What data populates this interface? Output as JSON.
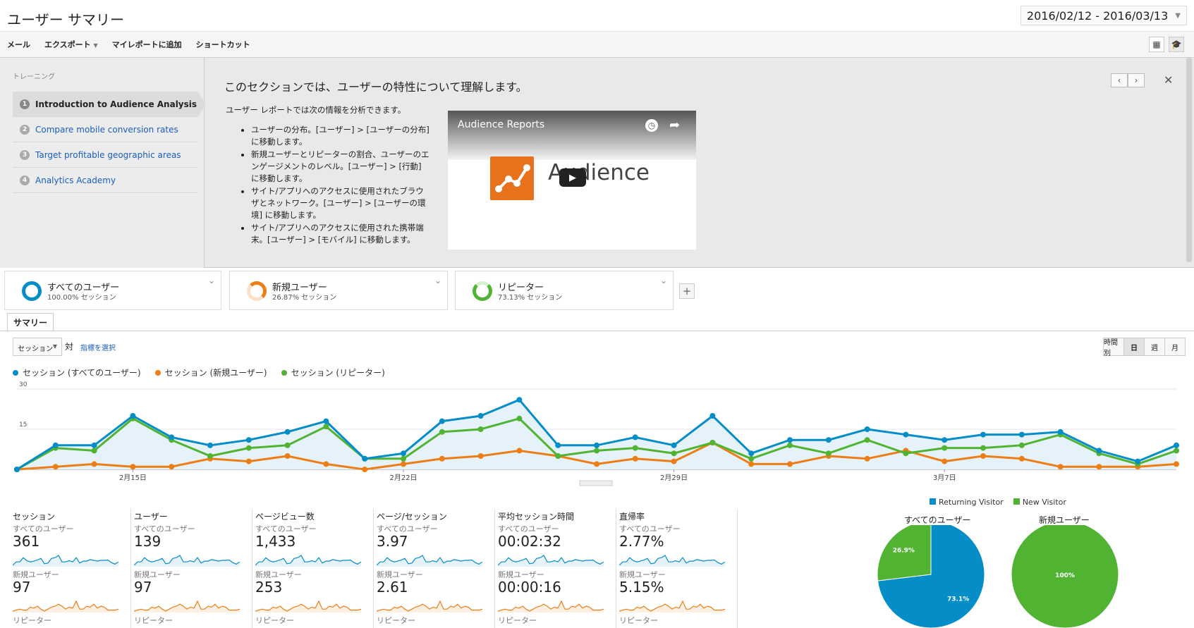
{
  "header": {
    "title": "ユーザー サマリー",
    "date_range": "2016/02/12 - 2016/03/13"
  },
  "toolbar": {
    "items": [
      "メール",
      "エクスポート",
      "マイレポートに追加",
      "ショートカット"
    ]
  },
  "training": {
    "label": "トレーニング",
    "items": [
      {
        "num": "1",
        "label": "Introduction to Audience Analysis"
      },
      {
        "num": "2",
        "label": "Compare mobile conversion rates"
      },
      {
        "num": "3",
        "label": "Target profitable geographic areas"
      },
      {
        "num": "4",
        "label": "Analytics Academy"
      }
    ],
    "heading": "このセクションでは、ユーザーの特性について理解します。",
    "intro": "ユーザー レポートでは次の情報を分析できます。",
    "bullets": [
      "ユーザーの分布。[ユーザー] > [ユーザーの分布] に移動します。",
      "新規ユーザーとリピーターの割合、ユーザーのエンゲージメントのレベル。[ユーザー] > [行動] に移動します。",
      "サイト/アプリへのアクセスに使用されたブラウザとネットワーク。[ユーザー] > [ユーザーの環境] に移動します。",
      "サイト/アプリへのアクセスに使用された携帯端末。[ユーザー] > [モバイル] に移動します。"
    ],
    "video": {
      "title": "Audience Reports",
      "wordmark": "Audience"
    }
  },
  "segments": [
    {
      "name": "すべてのユーザー",
      "pct": "100.00% セッション",
      "color": "#058dc7"
    },
    {
      "name": "新規ユーザー",
      "pct": "26.87% セッション",
      "color": "#ed7e17"
    },
    {
      "name": "リピーター",
      "pct": "73.13% セッション",
      "color": "#50b432"
    }
  ],
  "tabs": {
    "summary": "サマリー"
  },
  "controls": {
    "metric_select": "セッション",
    "vs": "対",
    "choose_metric": "指標を選択",
    "granularity": [
      "時間別",
      "日",
      "週",
      "月"
    ],
    "granularity_active": "日"
  },
  "chart_data": {
    "type": "line",
    "yticks": [
      30,
      15
    ],
    "ylim": [
      0,
      30
    ],
    "xtick_labels": [
      "2月15日",
      "2月22日",
      "2月29日",
      "3月7日"
    ],
    "xtick_index": [
      3,
      10,
      17,
      24
    ],
    "series": [
      {
        "name": "セッション (すべてのユーザー)",
        "color": "#058dc7",
        "values": [
          0,
          9,
          9,
          20,
          12,
          9,
          11,
          14,
          18,
          4,
          6,
          18,
          20,
          26,
          9,
          9,
          12,
          9,
          20,
          6,
          11,
          11,
          15,
          13,
          11,
          13,
          13,
          14,
          7,
          3,
          9
        ]
      },
      {
        "name": "セッション (新規ユーザー)",
        "color": "#ed7e17",
        "values": [
          0,
          1,
          2,
          1,
          1,
          4,
          3,
          5,
          2,
          0,
          2,
          4,
          5,
          7,
          5,
          2,
          4,
          3,
          10,
          2,
          2,
          5,
          4,
          7,
          3,
          5,
          4,
          1,
          1,
          1,
          2
        ]
      },
      {
        "name": "セッション (リピーター)",
        "color": "#50b432",
        "values": [
          0,
          8,
          7,
          19,
          11,
          5,
          8,
          9,
          16,
          4,
          4,
          14,
          15,
          19,
          5,
          7,
          8,
          6,
          10,
          4,
          9,
          6,
          11,
          6,
          8,
          8,
          9,
          13,
          6,
          2,
          7
        ]
      }
    ]
  },
  "metrics": [
    {
      "name": "セッション",
      "rows": [
        {
          "label": "すべてのユーザー",
          "value": "361"
        },
        {
          "label": "新規ユーザー",
          "value": "97"
        },
        {
          "label": "リピーター",
          "value": ""
        }
      ]
    },
    {
      "name": "ユーザー",
      "rows": [
        {
          "label": "すべてのユーザー",
          "value": "139"
        },
        {
          "label": "新規ユーザー",
          "value": "97"
        },
        {
          "label": "リピーター",
          "value": ""
        }
      ]
    },
    {
      "name": "ページビュー数",
      "rows": [
        {
          "label": "すべてのユーザー",
          "value": "1,433"
        },
        {
          "label": "新規ユーザー",
          "value": "253"
        },
        {
          "label": "リピーター",
          "value": ""
        }
      ]
    },
    {
      "name": "ページ/セッション",
      "rows": [
        {
          "label": "すべてのユーザー",
          "value": "3.97"
        },
        {
          "label": "新規ユーザー",
          "value": "2.61"
        },
        {
          "label": "リピーター",
          "value": ""
        }
      ]
    },
    {
      "name": "平均セッション時間",
      "rows": [
        {
          "label": "すべてのユーザー",
          "value": "00:02:32"
        },
        {
          "label": "新規ユーザー",
          "value": "00:00:16"
        },
        {
          "label": "リピーター",
          "value": ""
        }
      ]
    },
    {
      "name": "直帰率",
      "rows": [
        {
          "label": "すべてのユーザー",
          "value": "2.77%"
        },
        {
          "label": "新規ユーザー",
          "value": "5.15%"
        },
        {
          "label": "リピーター",
          "value": ""
        }
      ]
    }
  ],
  "pies": {
    "legend": [
      {
        "name": "Returning Visitor",
        "color": "#058dc7"
      },
      {
        "name": "New Visitor",
        "color": "#50b432"
      }
    ],
    "charts": [
      {
        "title": "すべてのユーザー",
        "slices": [
          {
            "label": "73.1%",
            "value": 73.1,
            "color": "#058dc7"
          },
          {
            "label": "26.9%",
            "value": 26.9,
            "color": "#50b432"
          }
        ]
      },
      {
        "title": "新規ユーザー",
        "slices": [
          {
            "label": "100%",
            "value": 100,
            "color": "#50b432"
          }
        ]
      }
    ]
  }
}
